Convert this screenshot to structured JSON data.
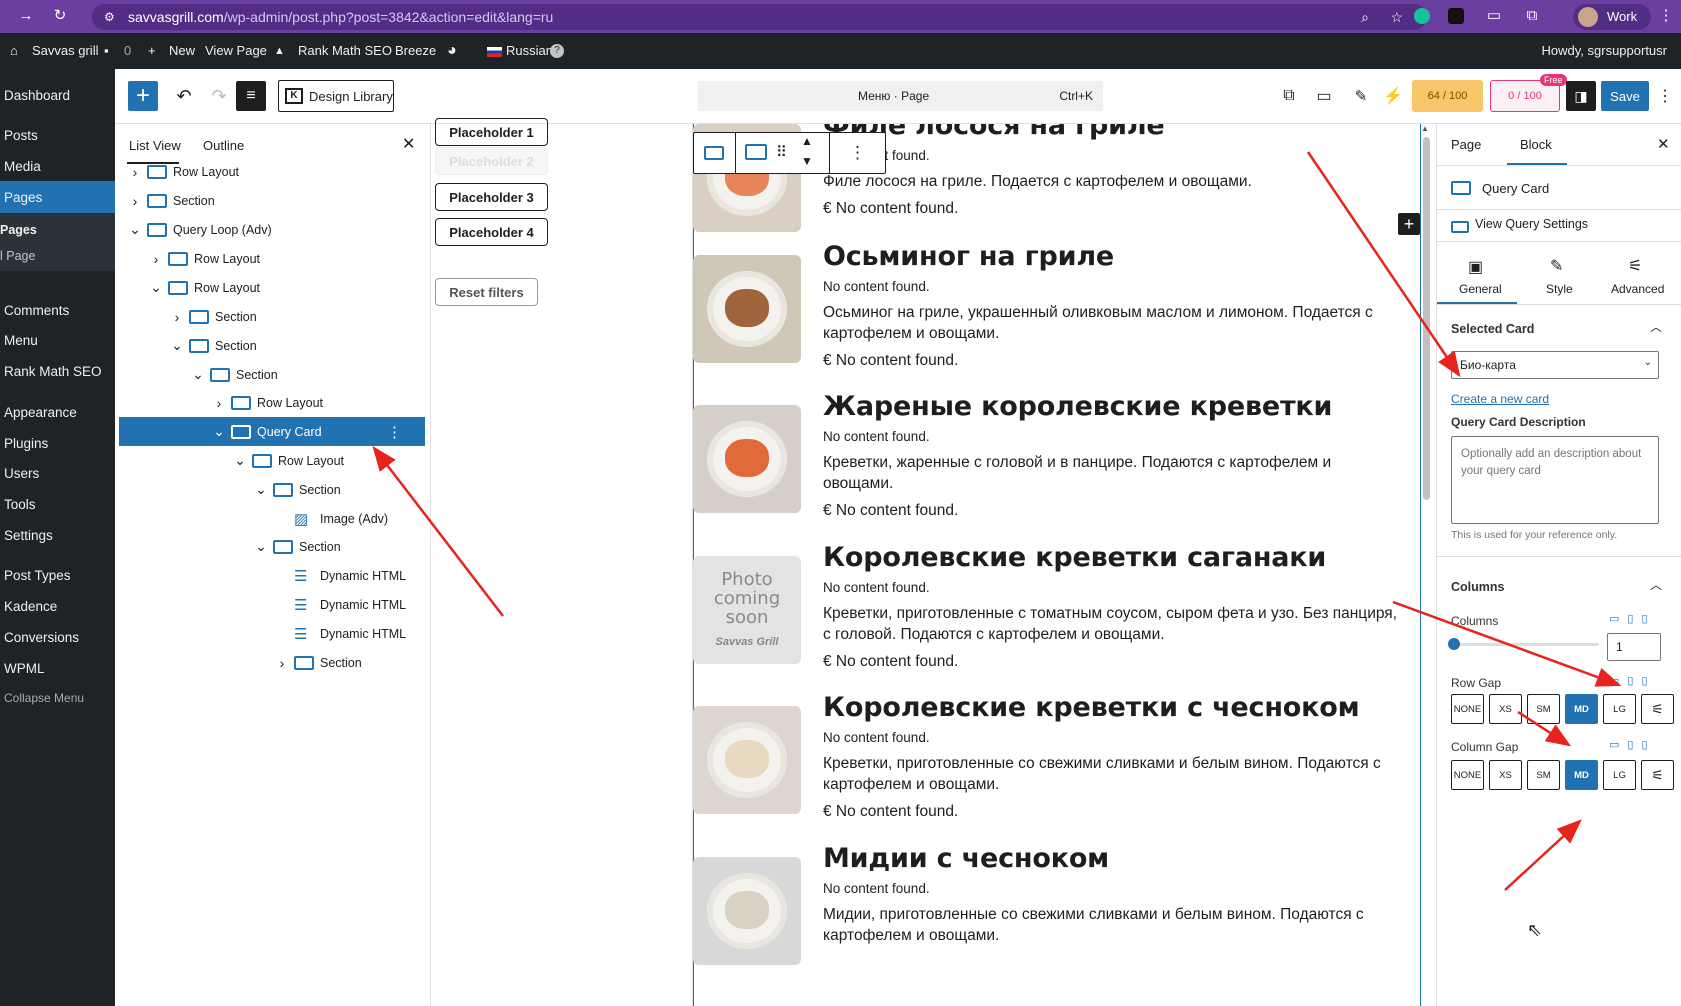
{
  "browser": {
    "url_host": "savvasgrill.com",
    "url_path": "/wp-admin/post.php?post=3842&action=edit&lang=ru",
    "profile": "Work"
  },
  "adminbar": {
    "site": "Savvas grill",
    "comments": "0",
    "new": "New",
    "view_page": "View Page",
    "rankmath": "Rank Math SEO",
    "breeze": "Breeze",
    "language": "Russian",
    "howdy": "Howdy, sgrsupportusr"
  },
  "adminmenu": {
    "items": [
      "Dashboard",
      "Posts",
      "Media",
      "Pages",
      "Pages",
      "l Page",
      "Comments",
      "Menu",
      "Rank Math SEO",
      "Appearance",
      "Plugins",
      "Users",
      "Tools",
      "Settings",
      "Post Types",
      "Kadence",
      "Conversions",
      "WPML",
      "Collapse Menu"
    ]
  },
  "toolbar": {
    "design_library": "Design Library",
    "command": "Меню · Page",
    "shortcut": "Ctrl+K",
    "score1": "64 / 100",
    "score2": "0 / 100",
    "free": "Free",
    "save": "Save"
  },
  "listview": {
    "tab_list": "List View",
    "tab_outline": "Outline",
    "rows": [
      {
        "label": "Row Layout"
      },
      {
        "label": "Section"
      },
      {
        "label": "Query Loop (Adv)"
      },
      {
        "label": "Row Layout"
      },
      {
        "label": "Row Layout"
      },
      {
        "label": "Section"
      },
      {
        "label": "Section"
      },
      {
        "label": "Section"
      },
      {
        "label": "Row Layout"
      },
      {
        "label": "Query Card"
      },
      {
        "label": "Row Layout"
      },
      {
        "label": "Section"
      },
      {
        "label": "Image (Adv)"
      },
      {
        "label": "Section"
      },
      {
        "label": "Dynamic HTML"
      },
      {
        "label": "Dynamic HTML"
      },
      {
        "label": "Dynamic HTML"
      },
      {
        "label": "Section"
      }
    ]
  },
  "filters": {
    "buttons": [
      "Placeholder 1",
      "Placeholder 2",
      "Placeholder 3",
      "Placeholder 4"
    ],
    "reset": "Reset filters"
  },
  "content": {
    "items": [
      {
        "title": "Филе лосося на гриле",
        "nocontent": "No content found.",
        "desc": "Филе лосося на гриле. Подается с картофелем и овощами.",
        "price": "€ No content found."
      },
      {
        "title": "Осьминог на гриле",
        "nocontent": "No content found.",
        "desc": "Осьминог на гриле, украшенный оливковым маслом и лимоном. Подается с картофелем и овощами.",
        "price": "€ No content found."
      },
      {
        "title": "Жареные королевские креветки",
        "nocontent": "No content found.",
        "desc": "Креветки, жаренные с головой и в панцире. Подаются с картофелем и овощами.",
        "price": "€ No content found."
      },
      {
        "title": "Королевские креветки саганаки",
        "nocontent": "No content found.",
        "desc": "Креветки, приготовленные с томатным соусом, сыром фета и узо. Без панциря, с головой. Подаются с картофелем и овощами.",
        "price": "€ No content found."
      },
      {
        "title": "Королевские креветки с чесноком",
        "nocontent": "No content found.",
        "desc": "Креветки, приготовленные со свежими сливками и белым вином. Подаются с картофелем и овощами.",
        "price": "€ No content found."
      },
      {
        "title": "Мидии с чесноком",
        "nocontent": "No content found.",
        "desc": "Мидии, приготовленные со свежими сливками и белым вином. Подаются с картофелем и овощами.",
        "price": ""
      }
    ],
    "photo_placeholder": "Photo coming soon",
    "photo_brand": "Savvas Grill"
  },
  "sidebar": {
    "tab_page": "Page",
    "tab_block": "Block",
    "block_name": "Query Card",
    "view_query": "View Query Settings",
    "tabs": [
      "General",
      "Style",
      "Advanced"
    ],
    "selected_card_heading": "Selected Card",
    "selected_card_value": "Био-карта",
    "create_link": "Create a new card",
    "desc_label": "Query Card Description",
    "desc_placeholder": "Optionally add an description about your query card",
    "desc_help": "This is used for your reference only.",
    "columns_heading": "Columns",
    "columns_label": "Columns",
    "columns_value": "1",
    "row_gap_label": "Row Gap",
    "col_gap_label": "Column Gap",
    "gap_options": [
      "NONE",
      "XS",
      "SM",
      "MD",
      "LG"
    ],
    "gap_selected": "MD"
  },
  "colors": {
    "accent": "#2271b1",
    "admin_dark": "#1d2327",
    "browser": "#6b3fa0",
    "annotation": "#e8231b"
  }
}
